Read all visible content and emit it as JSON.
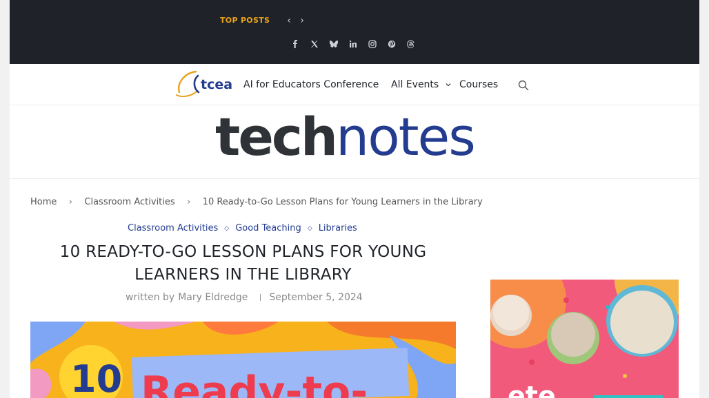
{
  "topbar": {
    "top_posts_label": "TOP POSTS",
    "prev_label": "‹",
    "next_label": "›",
    "socials": [
      "facebook-icon",
      "x-icon",
      "bluesky-icon",
      "linkedin-icon",
      "instagram-icon",
      "pinterest-icon",
      "threads-icon"
    ],
    "background": "#1f2329",
    "accent": "#e8a21c"
  },
  "navbar": {
    "logo_text": "tcea",
    "items": [
      {
        "label": "AI for Educators Conference"
      },
      {
        "label": "All Events"
      },
      {
        "label": "Courses"
      }
    ],
    "dropdown_icon": "chevron-down-icon",
    "search_icon": "search-icon"
  },
  "brand": {
    "tech": "tech",
    "notes": "notes",
    "tech_color": "#2f3337",
    "notes_color": "#233c90"
  },
  "breadcrumb": {
    "items": [
      "Home",
      "Classroom Activities",
      "10 Ready-to-Go Lesson Plans for Young Learners in the Library"
    ],
    "separator": "›"
  },
  "post": {
    "categories": [
      "Classroom Activities",
      "Good Teaching",
      "Libraries"
    ],
    "category_separator": "◇",
    "title": "10 Ready-to-Go Lesson Plans for Young Learners in the Library",
    "byline_prefix": "written by",
    "author": "Mary Eldredge",
    "date": "September 5, 2024",
    "hero_image": {
      "number": "10",
      "text": "Ready-to-"
    }
  },
  "sidebar": {
    "ad_text": "ete"
  }
}
